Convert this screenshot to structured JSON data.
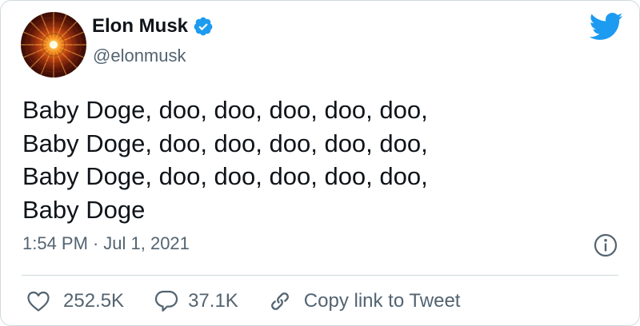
{
  "author": {
    "name": "Elon Musk",
    "handle": "@elonmusk",
    "verified": true
  },
  "icons": {
    "brand": "twitter-bird-icon",
    "verified": "verified-badge-icon",
    "info": "info-icon",
    "like": "heart-icon",
    "reply": "reply-bubble-icon",
    "copy_link": "link-icon"
  },
  "tweet": {
    "lines": [
      "Baby Doge, doo, doo, doo, doo, doo,",
      "Baby Doge, doo, doo, doo, doo, doo,",
      "Baby Doge, doo, doo, doo, doo, doo,",
      "Baby Doge"
    ],
    "time": "1:54 PM",
    "separator": "·",
    "date": "Jul 1, 2021"
  },
  "actions": {
    "likes": "252.5K",
    "replies": "37.1K",
    "copy_link_label": "Copy link to Tweet"
  },
  "colors": {
    "brand_blue": "#1d9bf0",
    "text_primary": "#0f1419",
    "text_secondary": "#536471",
    "border": "#cfd9de"
  }
}
